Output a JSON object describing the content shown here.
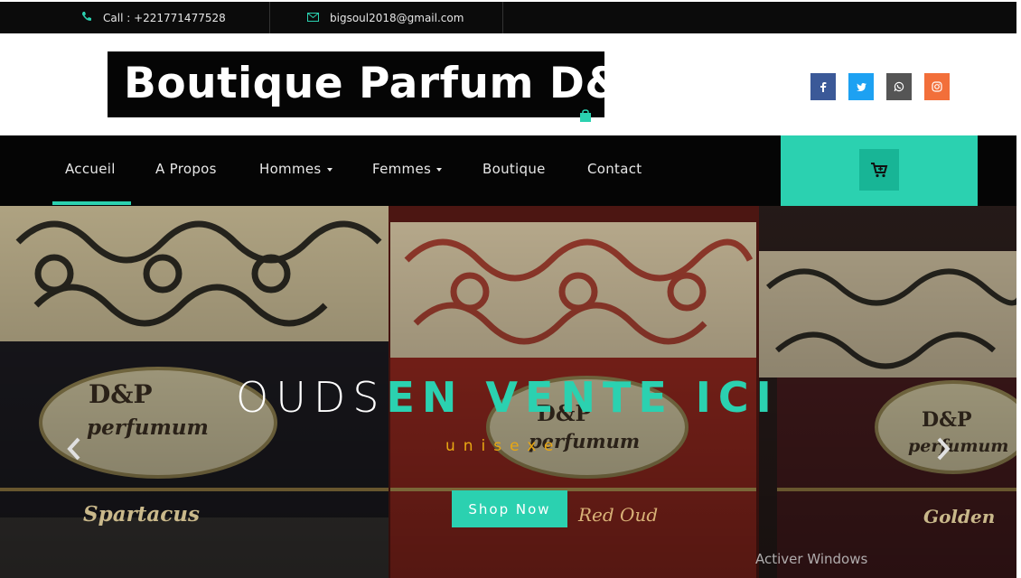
{
  "topbar": {
    "phone_icon": "phone-icon",
    "phone": "Call : +221771477528",
    "email_icon": "envelope-icon",
    "email": "bigsoul2018@gmail.com"
  },
  "header": {
    "logo_text": "Boutique Parfum D&P",
    "social": [
      {
        "name": "facebook-icon",
        "glyph": "f",
        "color": "#3b5998"
      },
      {
        "name": "twitter-icon",
        "glyph": "t",
        "color": "#1da1f2"
      },
      {
        "name": "whatsapp-icon",
        "glyph": "w",
        "color": "#555555"
      },
      {
        "name": "instagram-icon",
        "glyph": "i",
        "color": "#f26f3a"
      }
    ]
  },
  "nav": {
    "items": [
      {
        "label": "Accueil"
      },
      {
        "label": "A Propos"
      },
      {
        "label": "Hommes"
      },
      {
        "label": "Femmes"
      },
      {
        "label": "Boutique"
      },
      {
        "label": "Contact"
      }
    ],
    "cart_icon": "cart-icon"
  },
  "hero": {
    "headline_thin": "OUDS",
    "headline_bold": "EN VENTE ICI",
    "subtitle": "unisexe",
    "cta": "Shop Now",
    "prev_icon": "chevron-left-icon",
    "next_icon": "chevron-right-icon",
    "watermark": "Activer Windows",
    "box_text_1": "D&P",
    "box_text_2": "perfumum",
    "box_name_left": "Spartacus",
    "box_name_right": "Golden",
    "box_name_mid": "Red Oud"
  },
  "colors": {
    "accent": "#2bd1b0",
    "subtitle": "#e8a712",
    "nav_bg": "#050505"
  }
}
